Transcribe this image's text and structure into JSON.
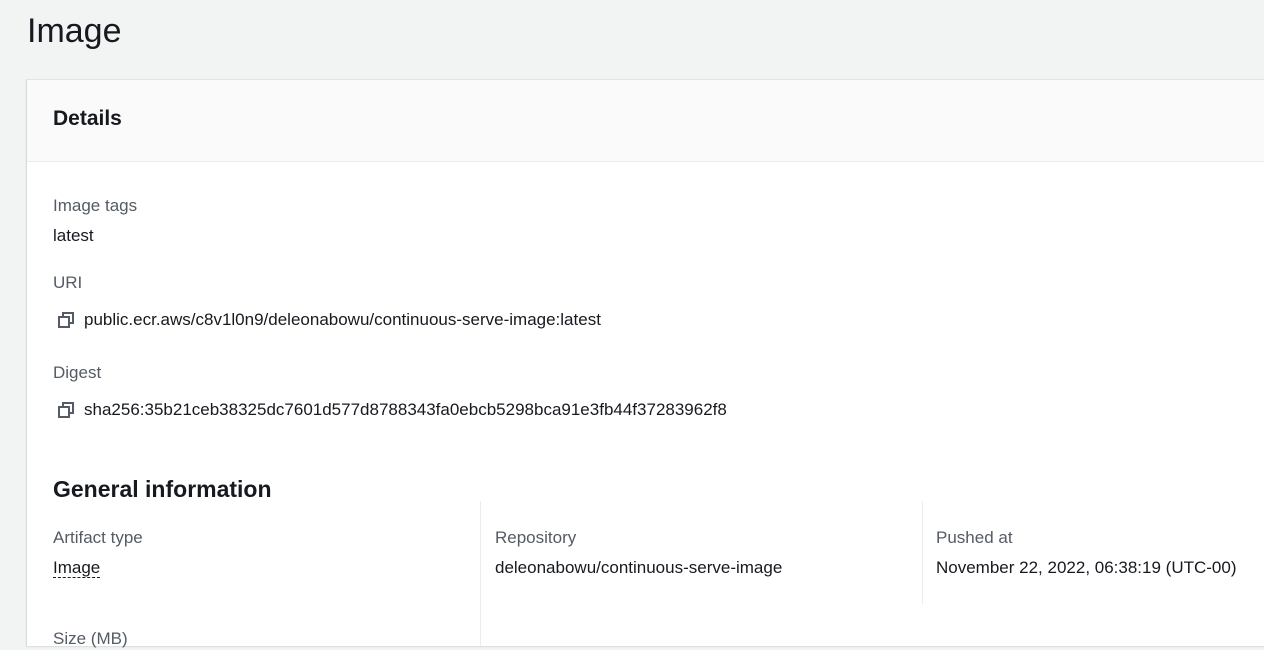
{
  "page": {
    "title": "Image"
  },
  "details": {
    "header": "Details",
    "image_tags_label": "Image tags",
    "image_tags_value": "latest",
    "uri_label": "URI",
    "uri_value": "public.ecr.aws/c8v1l0n9/deleonabowu/continuous-serve-image:latest",
    "digest_label": "Digest",
    "digest_value": "sha256:35b21ceb38325dc7601d577d8788343fa0ebcb5298bca91e3fb44f37283962f8"
  },
  "general": {
    "title": "General information",
    "artifact_type_label": "Artifact type",
    "artifact_type_value": "Image",
    "repository_label": "Repository",
    "repository_value": "deleonabowu/continuous-serve-image",
    "pushed_at_label": "Pushed at",
    "pushed_at_value": "November 22, 2022, 06:38:19 (UTC-00)",
    "size_label": "Size (MB)"
  },
  "icons": {
    "copy": "copy-icon"
  }
}
